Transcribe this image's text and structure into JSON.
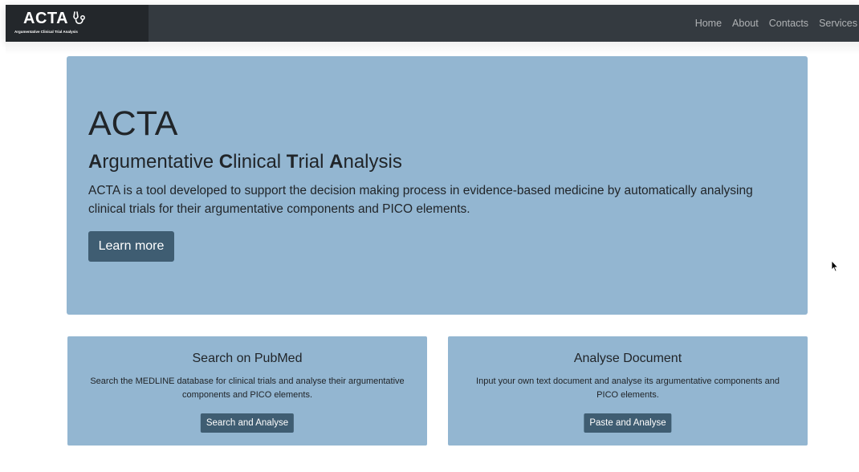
{
  "navbar": {
    "brand_name": "ACTA",
    "brand_icon": "stethoscope-icon",
    "brand_tagline": "Argumentative Clinical Trial Analysis",
    "links": [
      "Home",
      "About",
      "Contacts",
      "Services"
    ]
  },
  "hero": {
    "title": "ACTA",
    "subtitle_parts": [
      {
        "text": "A",
        "bold": true
      },
      {
        "text": "rgumentative ",
        "bold": false
      },
      {
        "text": "C",
        "bold": true
      },
      {
        "text": "linical ",
        "bold": false
      },
      {
        "text": "T",
        "bold": true
      },
      {
        "text": "rial ",
        "bold": false
      },
      {
        "text": "A",
        "bold": true
      },
      {
        "text": "nalysis",
        "bold": false
      }
    ],
    "description": "ACTA is a tool developed to support the decision making process in evidence-based medicine by automatically analysing clinical trials for their argumentative components and PICO elements.",
    "button_label": "Learn more"
  },
  "cards": [
    {
      "title": "Search on PubMed",
      "text": "Search the MEDLINE database for clinical trials and analyse their argumentative components and PICO elements.",
      "button_label": "Search and Analyse"
    },
    {
      "title": "Analyse Document",
      "text": "Input your own text document and analyse its argumentative components and PICO elements.",
      "button_label": "Paste and Analyse"
    }
  ],
  "colors": {
    "navbar": "#343a40",
    "brand_bg": "#23272b",
    "panel": "#93b6d1",
    "button": "#3f5d72"
  }
}
